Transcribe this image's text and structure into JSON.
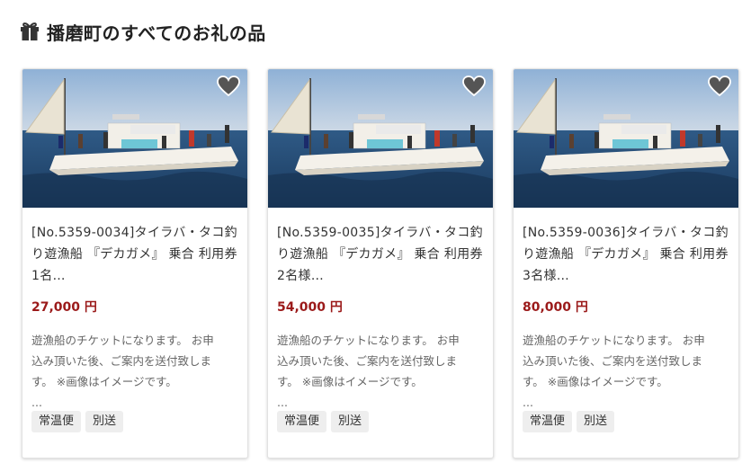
{
  "header": {
    "title": "播磨町のすべてのお礼の品",
    "icon": "gift-icon"
  },
  "colors": {
    "price": "#9b1a1a",
    "tag_bg": "#eeeeee",
    "icon": "#555555"
  },
  "cards": [
    {
      "title": "[No.5359-0034]タイラバ・タコ釣り遊漁船 『デカガメ』 乗合 利用券 1名…",
      "price": "27,000 円",
      "desc_line1": "遊漁船のチケットになります。 お申",
      "desc_line2": "込み頂いた後、ご案内を送付致しま",
      "desc_line3": "す。 ※画像はイメージです。",
      "desc_more": "...",
      "tags": [
        "常温便",
        "別送"
      ]
    },
    {
      "title": "[No.5359-0035]タイラバ・タコ釣り遊漁船 『デカガメ』 乗合 利用券 2名様…",
      "price": "54,000 円",
      "desc_line1": "遊漁船のチケットになります。 お申",
      "desc_line2": "込み頂いた後、ご案内を送付致しま",
      "desc_line3": "す。 ※画像はイメージです。",
      "desc_more": "...",
      "tags": [
        "常温便",
        "別送"
      ]
    },
    {
      "title": "[No.5359-0036]タイラバ・タコ釣り遊漁船 『デカガメ』 乗合 利用券 3名様…",
      "price": "80,000 円",
      "desc_line1": "遊漁船のチケットになります。 お申",
      "desc_line2": "込み頂いた後、ご案内を送付致しま",
      "desc_line3": "す。 ※画像はイメージです。",
      "desc_more": "...",
      "tags": [
        "常温便",
        "別送"
      ]
    }
  ]
}
